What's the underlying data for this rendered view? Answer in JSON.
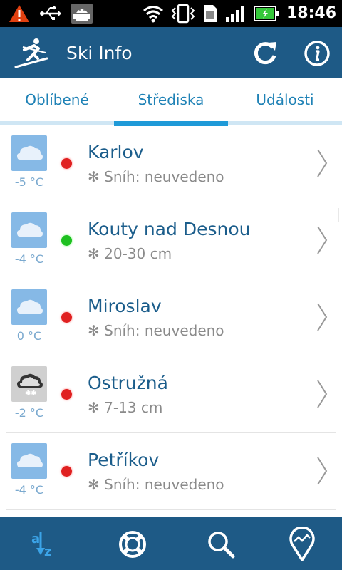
{
  "status_bar": {
    "time": "18:46",
    "icons": [
      "warning-icon",
      "usb-icon",
      "android-debug-icon",
      "wifi-icon",
      "vibrate-icon",
      "sim-icon",
      "signal-icon",
      "battery-charging-icon"
    ]
  },
  "app_bar": {
    "title": "Ski Info",
    "icons": [
      "skier-logo-icon",
      "refresh-icon",
      "info-icon"
    ]
  },
  "tabs": {
    "items": [
      {
        "label": "Oblíbené"
      },
      {
        "label": "Střediska"
      },
      {
        "label": "Události"
      }
    ],
    "selected": "Střediska"
  },
  "resorts": [
    {
      "name": "Karlov",
      "temp": "-5 °C",
      "snow": "Sníh: neuvedeno",
      "status_color": "#e02020",
      "weather": "cloudy-icon"
    },
    {
      "name": "Kouty nad Desnou",
      "temp": "-4 °C",
      "snow": "20-30 cm",
      "status_color": "#1ec020",
      "weather": "cloudy-icon"
    },
    {
      "name": "Miroslav",
      "temp": "0 °C",
      "snow": "Sníh: neuvedeno",
      "status_color": "#e02020",
      "weather": "cloudy-icon"
    },
    {
      "name": "Ostružná",
      "temp": "-2 °C",
      "snow": "7-13 cm",
      "status_color": "#e02020",
      "weather": "snow-cloud-icon"
    },
    {
      "name": "Petříkov",
      "temp": "-4 °C",
      "snow": "Sníh: neuvedeno",
      "status_color": "#e02020",
      "weather": "cloudy-icon"
    }
  ],
  "bottom_bar": {
    "icons": [
      "sort-az-icon",
      "lifebuoy-icon",
      "search-icon",
      "map-pin-icon"
    ]
  },
  "colors": {
    "app_bar": "#1e5a86",
    "accent": "#1f9ad8",
    "status_open": "#1ec020",
    "status_closed": "#e02020"
  }
}
